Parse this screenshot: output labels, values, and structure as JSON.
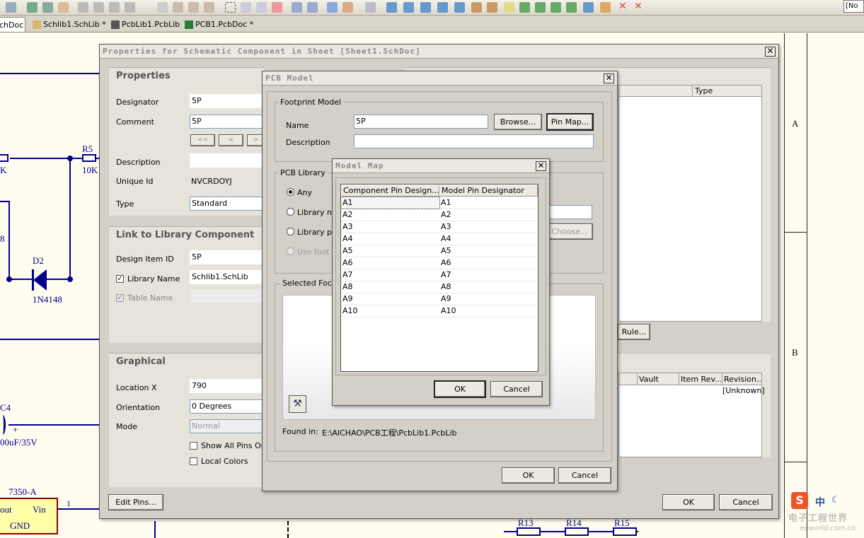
{
  "toolbar": {
    "right_box": "[No V"
  },
  "tabs": [
    {
      "label": "chDoc"
    },
    {
      "label": "Schlib1.SchLib *"
    },
    {
      "label": "PcbLib1.PcbLib"
    },
    {
      "label": "PCB1.PcbDoc *"
    }
  ],
  "schematic": {
    "border_labels": {
      "a": "A",
      "b": "B"
    },
    "components": {
      "r5": "R5",
      "r5_val": "10K",
      "k_frag": "K",
      "frag_8": "8",
      "d2": "D2",
      "d2_val": "1N4148",
      "c4": "C4",
      "c4_val": "00uF/35V",
      "plus": "+",
      "ic_name": "7350-A",
      "ic_out": "out",
      "ic_vin": "Vin",
      "ic_gnd": "GND",
      "pin1": "1",
      "r13": "R13",
      "r14": "R14",
      "r15": "R15"
    }
  },
  "props_dialog": {
    "title": "Properties for Schematic Component in Sheet [Sheet1.SchDoc]",
    "properties": {
      "heading": "Properties",
      "designator_label": "Designator",
      "designator_value": "5P",
      "comment_label": "Comment",
      "comment_value": "5P",
      "nav": [
        "<<",
        "<",
        ">"
      ],
      "description_label": "Description",
      "unique_id_label": "Unique Id",
      "unique_id_value": "NVCRDOYJ",
      "type_label": "Type",
      "type_value": "Standard"
    },
    "link": {
      "heading": "Link to Library Component",
      "design_item_label": "Design Item ID",
      "design_item_value": "5P",
      "library_name_label": "Library Name",
      "library_name_value": "Schlib1.SchLib",
      "table_name_label": "Table Name"
    },
    "graphical": {
      "heading": "Graphical",
      "location_label": "Location  X",
      "location_value": "790",
      "orientation_label": "Orientation",
      "orientation_value": "0 Degrees",
      "mode_label": "Mode",
      "mode_value": "Normal",
      "show_all_pins": "Show All Pins On",
      "local_colors": "Local Colors"
    },
    "right_panel": {
      "type_header": "Type",
      "rule_button": "Rule...",
      "cols": [
        "Vault",
        "Item Rev...",
        "Revision..."
      ],
      "revision_value": "[Unknown]"
    },
    "edit_pins": "Edit Pins...",
    "ok": "OK",
    "cancel": "Cancel"
  },
  "pcb_dialog": {
    "title": "PCB Model",
    "footprint_group": "Footprint Model",
    "name_label": "Name",
    "name_value": "5P",
    "browse": "Browse...",
    "pin_map": "Pin Map...",
    "description_label": "Description",
    "library_group": "PCB Library",
    "radio_any": "Any",
    "radio_libname": "Library n",
    "radio_libpath": "Library p",
    "radio_usefoot": "Use foot",
    "choose": "Choose...",
    "selected_group": "Selected Foc",
    "found_in_label": "Found in:",
    "found_in_value": "E:\\AICHAO\\PCB工程\\PcbLib1.PcbLib",
    "ok": "OK",
    "cancel": "Cancel"
  },
  "map_dialog": {
    "title": "Model Map",
    "col_component": "Component Pin Design...",
    "col_model": "Model Pin Designator",
    "rows": [
      [
        "A1",
        "A1"
      ],
      [
        "A2",
        "A2"
      ],
      [
        "A3",
        "A3"
      ],
      [
        "A4",
        "A4"
      ],
      [
        "A5",
        "A5"
      ],
      [
        "A6",
        "A6"
      ],
      [
        "A7",
        "A7"
      ],
      [
        "A8",
        "A8"
      ],
      [
        "A9",
        "A9"
      ],
      [
        "A10",
        "A10"
      ]
    ],
    "ok": "OK",
    "cancel": "Cancel"
  },
  "watermark": {
    "cn": "电子工程世界",
    "en": "eeworld.com.cn",
    "ime": "中"
  }
}
